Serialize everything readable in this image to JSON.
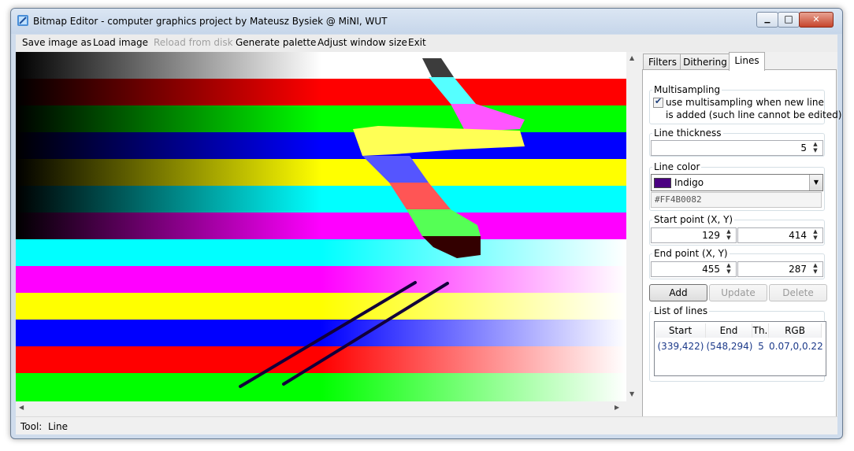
{
  "window": {
    "title": "Bitmap Editor - computer graphics project by Mateusz Bysiek @ MiNI, WUT",
    "controls": {
      "minimize": "▁",
      "maximize": "□",
      "close": "✕"
    }
  },
  "menu": {
    "save_image": "Save image as",
    "load_image": "Load image",
    "reload": "Reload from disk",
    "generate_palette": "Generate palette",
    "adjust_size": "Adjust window size",
    "exit": "Exit"
  },
  "tabs": {
    "filters": "Filters",
    "dithering": "Dithering",
    "lines": "Lines"
  },
  "multisampling": {
    "title": "Multisampling",
    "line1": "use multisampling when new line",
    "line2": "is added (such line cannot be edited)",
    "checked": true
  },
  "thickness": {
    "title": "Line thickness",
    "value": "5"
  },
  "color": {
    "title": "Line color",
    "name": "Indigo",
    "hex": "#FF4B0082",
    "swatch": "#4b0082"
  },
  "start": {
    "title": "Start point (X, Y)",
    "x": "129",
    "y": "414"
  },
  "end": {
    "title": "End point (X, Y)",
    "x": "455",
    "y": "287"
  },
  "buttons": {
    "add": "Add",
    "update": "Update",
    "delete": "Delete"
  },
  "list": {
    "title": "List of lines",
    "headers": [
      "Start",
      "End",
      "Th.",
      "RGB"
    ],
    "rows": [
      [
        "(339,422)",
        "(548,294)",
        "5",
        "0.07,0,0.22"
      ]
    ]
  },
  "status": {
    "label": "Tool:",
    "value": "Line"
  },
  "canvas": {
    "bands": [
      {
        "dark": "#000000",
        "full": "#ffffff",
        "light": "#ffffff"
      },
      {
        "dark": "#000000",
        "full": "#ff0000",
        "light": "#ff0000"
      },
      {
        "dark": "#000000",
        "full": "#00ff00",
        "light": "#00ff00"
      },
      {
        "dark": "#000000",
        "full": "#0000ff",
        "light": "#0000ff"
      },
      {
        "dark": "#000000",
        "full": "#ffff00",
        "light": "#ffff00"
      },
      {
        "dark": "#000000",
        "full": "#00ffff",
        "light": "#00ffff"
      },
      {
        "dark": "#000000",
        "full": "#ff00ff",
        "light": "#ff00ff"
      },
      {
        "dark": "#00ffff",
        "full": "#00ffff",
        "light": "#ffffff"
      },
      {
        "dark": "#ff00ff",
        "full": "#ff00ff",
        "light": "#ffffff"
      },
      {
        "dark": "#ffff00",
        "full": "#ffff00",
        "light": "#ffffff"
      },
      {
        "dark": "#0000ff",
        "full": "#0000ff",
        "light": "#ffffff"
      },
      {
        "dark": "#ff0000",
        "full": "#ff0000",
        "light": "#ffffff"
      },
      {
        "dark": "#00ff00",
        "full": "#00ff00",
        "light": "#ffffff"
      }
    ],
    "stroke_colors": [
      "#3c3c3c",
      "#55ffff",
      "#ff55ff",
      "#ffff55",
      "#5555ff",
      "#ff5555",
      "#55ff55",
      "#330000"
    ],
    "line_color": "#12003a"
  }
}
